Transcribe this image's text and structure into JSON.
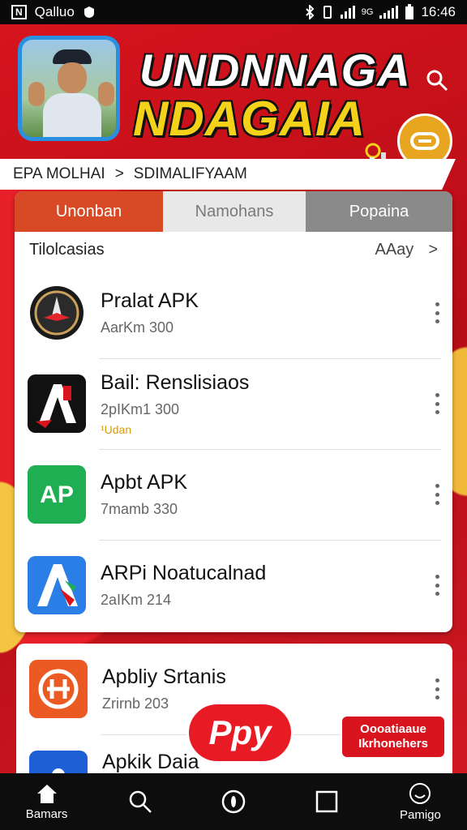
{
  "status_bar": {
    "left_box": "N",
    "left_text": "Qalluo",
    "time": "16:46",
    "signal_label": "9G"
  },
  "header": {
    "title_line1": "UNDNNAGA",
    "title_line2": "NDAGAIA"
  },
  "breadcrumb": {
    "first": "EPA MOLHAI",
    "separator": ">",
    "second": "SDIMALIFYAAM"
  },
  "tabs": [
    {
      "label": "Unonban"
    },
    {
      "label": "Namohans"
    },
    {
      "label": "Popaina"
    }
  ],
  "section": {
    "title": "Tilolcasias",
    "more_label": "AAay",
    "more_arrow": ">"
  },
  "apps": [
    {
      "name": "Pralat APK",
      "meta": "AarKm 300",
      "extra": ""
    },
    {
      "name": "Bail: Renslisiaos",
      "meta": "2pIKm1 300",
      "extra": "¹Udan"
    },
    {
      "name": "Apbt APK",
      "meta": "7mamb 330",
      "extra": ""
    },
    {
      "name": "ARPi Noatucalnad",
      "meta": "2aIKm 214",
      "extra": ""
    }
  ],
  "apps2": [
    {
      "name": "Apbliy Srtanis",
      "meta": "Zrirnb 203"
    },
    {
      "name": "Apkik Daia",
      "meta": ""
    }
  ],
  "floating": {
    "pill_label": "Ppy",
    "promo_line1": "Oooatiaaue",
    "promo_line2": "Ikrhonehers"
  },
  "bottom_nav": [
    {
      "label": "Bamars",
      "icon": "home-icon"
    },
    {
      "label": "",
      "icon": "search-icon"
    },
    {
      "label": "",
      "icon": "compass-icon"
    },
    {
      "label": "",
      "icon": "square-icon"
    },
    {
      "label": "Pamigo",
      "icon": "smiley-icon"
    }
  ],
  "colors": {
    "brand_red": "#c8101a",
    "accent_yellow": "#f5d21a",
    "tab_active": "#d84a26",
    "badge_gold": "#e8a51f"
  }
}
